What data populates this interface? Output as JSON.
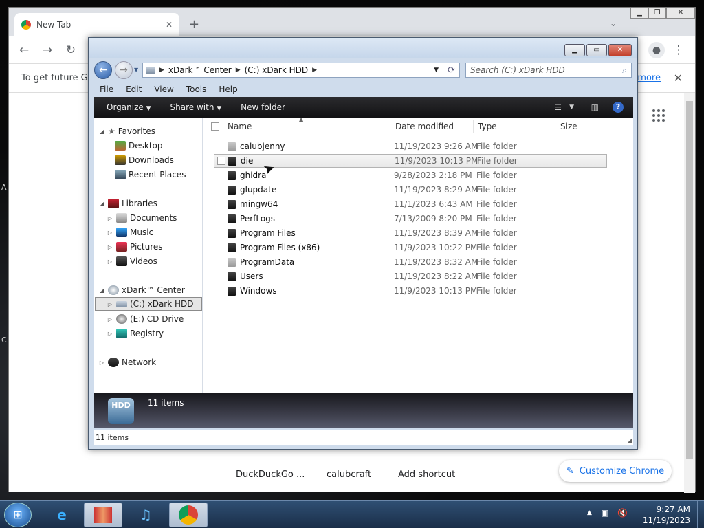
{
  "chrome": {
    "tab_title": "New Tab",
    "infobar_text": "To get future Goo",
    "infobar_link": "more",
    "shortcuts": [
      "DuckDuckGo ...",
      "calubcraft",
      "Add shortcut"
    ],
    "customize_label": "Customize Chrome"
  },
  "explorer": {
    "breadcrumbs": [
      "xDark™ Center",
      "(C:) xDark HDD"
    ],
    "search_placeholder": "Search (C:) xDark HDD",
    "menu": [
      "File",
      "Edit",
      "View",
      "Tools",
      "Help"
    ],
    "commands": {
      "organize": "Organize",
      "share_with": "Share with",
      "new_folder": "New folder"
    },
    "nav": {
      "favorites": {
        "label": "Favorites",
        "items": [
          "Desktop",
          "Downloads",
          "Recent Places"
        ]
      },
      "libraries": {
        "label": "Libraries",
        "items": [
          "Documents",
          "Music",
          "Pictures",
          "Videos"
        ]
      },
      "computer": {
        "label": "xDark™ Center",
        "items": [
          "(C:) xDark HDD",
          "(E:) CD Drive",
          "Registry"
        ]
      },
      "network": "Network"
    },
    "columns": {
      "name": "Name",
      "date": "Date modified",
      "type": "Type",
      "size": "Size"
    },
    "files": [
      {
        "name": "calubjenny",
        "date": "11/19/2023 9:26 AM",
        "type": "File folder"
      },
      {
        "name": "die",
        "date": "11/9/2023 10:13 PM",
        "type": "File folder"
      },
      {
        "name": "ghidra",
        "date": "9/28/2023 2:18 PM",
        "type": "File folder"
      },
      {
        "name": "glupdate",
        "date": "11/19/2023 8:29 AM",
        "type": "File folder"
      },
      {
        "name": "mingw64",
        "date": "11/1/2023 6:43 AM",
        "type": "File folder"
      },
      {
        "name": "PerfLogs",
        "date": "7/13/2009 8:20 PM",
        "type": "File folder"
      },
      {
        "name": "Program Files",
        "date": "11/19/2023 8:39 AM",
        "type": "File folder"
      },
      {
        "name": "Program Files (x86)",
        "date": "11/9/2023 10:22 PM",
        "type": "File folder"
      },
      {
        "name": "ProgramData",
        "date": "11/19/2023 8:32 AM",
        "type": "File folder"
      },
      {
        "name": "Users",
        "date": "11/19/2023 8:22 AM",
        "type": "File folder"
      },
      {
        "name": "Windows",
        "date": "11/9/2023 10:13 PM",
        "type": "File folder"
      }
    ],
    "details_count": "11 items",
    "hdd_label": "HDD",
    "status_count": "11 items"
  },
  "taskbar": {
    "time": "9:27 AM",
    "date": "11/19/2023"
  }
}
